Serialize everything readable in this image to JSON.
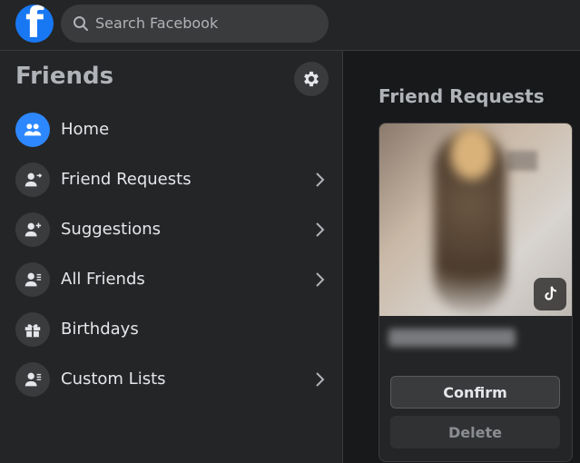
{
  "topbar": {
    "logo_letter": "f",
    "search_placeholder": "Search Facebook"
  },
  "sidebar": {
    "title": "Friends",
    "items": [
      {
        "label": "Home",
        "icon": "friends-home-icon",
        "active": true,
        "chevron": false
      },
      {
        "label": "Friend Requests",
        "icon": "friend-request-icon",
        "active": false,
        "chevron": true
      },
      {
        "label": "Suggestions",
        "icon": "friend-add-icon",
        "active": false,
        "chevron": true
      },
      {
        "label": "All Friends",
        "icon": "friend-list-icon",
        "active": false,
        "chevron": true
      },
      {
        "label": "Birthdays",
        "icon": "gift-icon",
        "active": false,
        "chevron": false
      },
      {
        "label": "Custom Lists",
        "icon": "friend-list-icon",
        "active": false,
        "chevron": true
      }
    ]
  },
  "main": {
    "section_title": "Friend Requests",
    "card": {
      "confirm_label": "Confirm",
      "delete_label": "Delete"
    }
  },
  "colors": {
    "accent": "#1877f2",
    "active_icon": "#2d88ff",
    "background": "#18191a",
    "surface": "#242526"
  }
}
